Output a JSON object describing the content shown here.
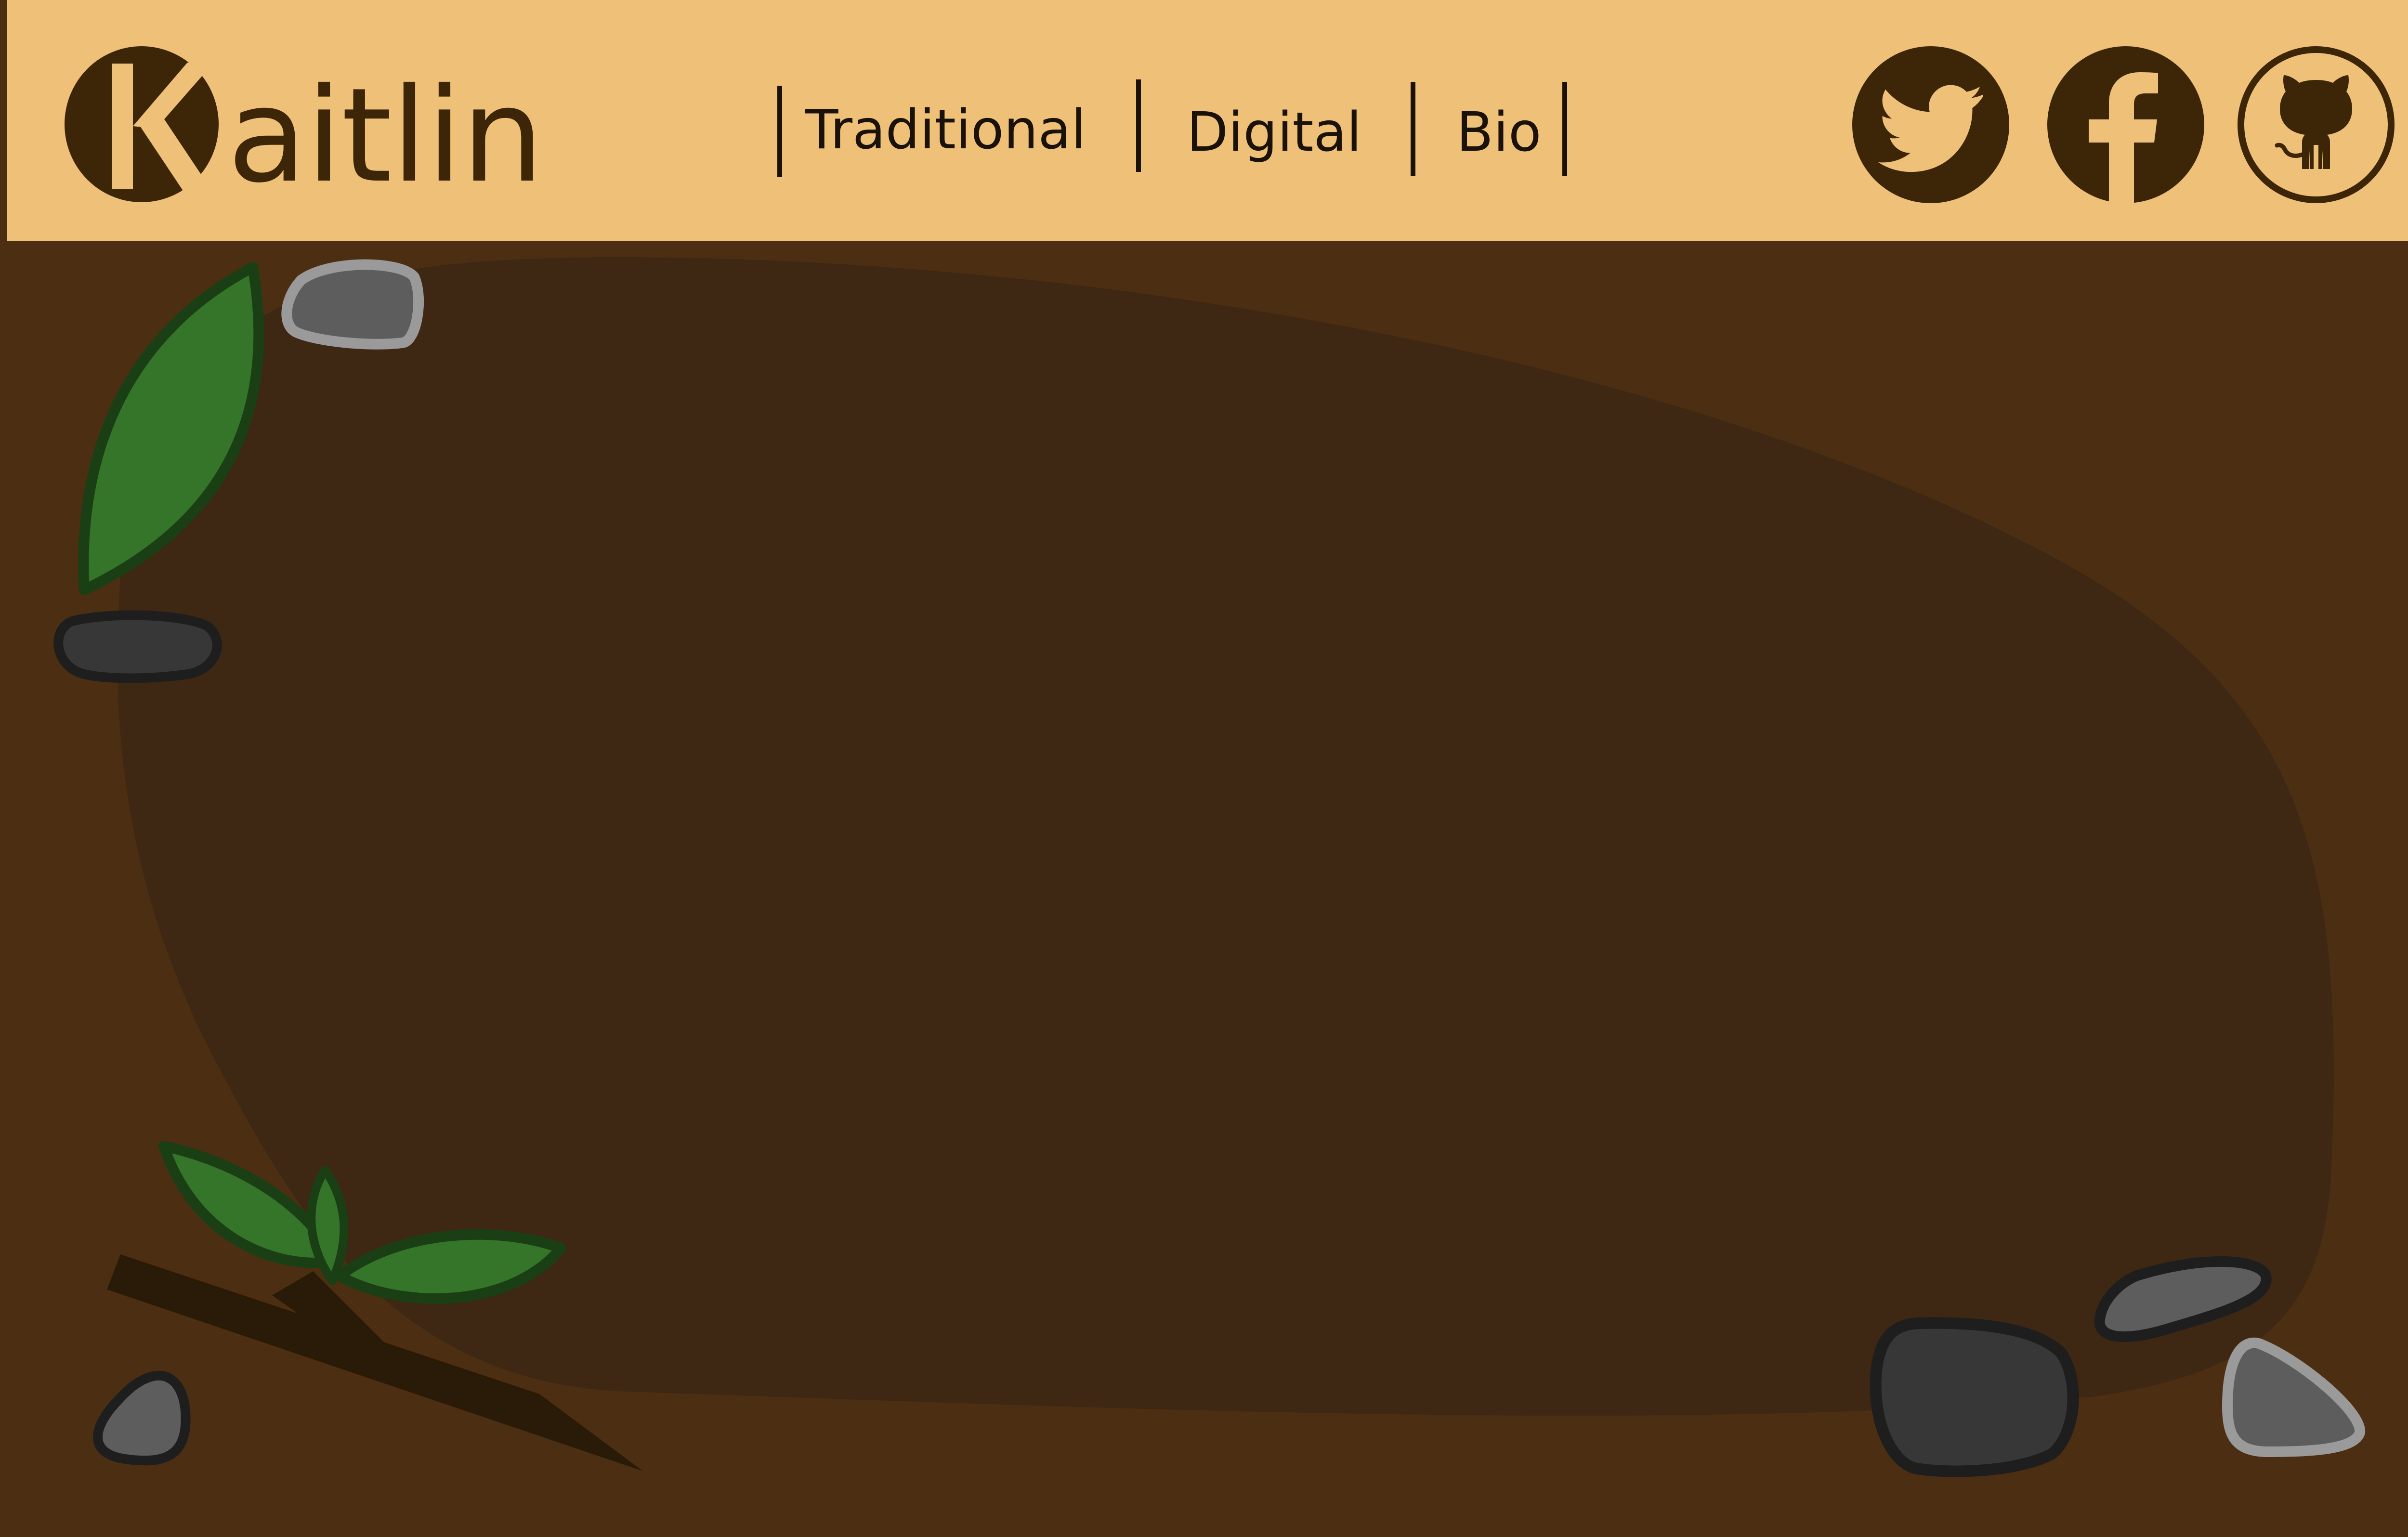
{
  "header": {
    "logo_initial": "K",
    "logo_rest": "aitlin",
    "nav": [
      {
        "label": "Traditional"
      },
      {
        "label": "Digital"
      },
      {
        "label": "Bio"
      }
    ],
    "social": [
      {
        "name": "Twitter",
        "icon": "twitter-icon"
      },
      {
        "name": "Facebook",
        "icon": "facebook-icon"
      },
      {
        "name": "GitHub",
        "icon": "github-icon"
      }
    ]
  },
  "colors": {
    "header_bg": "#efc077",
    "page_bg": "#4c2f12",
    "content_blob": "#3e2713",
    "logo_brown": "#3d2608",
    "leaf_green": "#357529",
    "leaf_outline": "#1b3f15",
    "rock_dark": "#373737",
    "rock_grey": "#5d5d5d",
    "rock_outline_light": "#9a9a9a",
    "stick": "#2a1a08"
  }
}
